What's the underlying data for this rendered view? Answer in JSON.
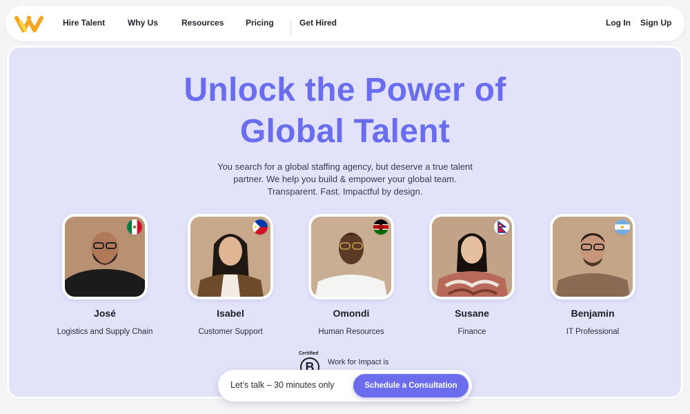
{
  "nav": {
    "items": [
      {
        "label": "Hire Talent"
      },
      {
        "label": "Why Us"
      },
      {
        "label": "Resources"
      },
      {
        "label": "Pricing"
      },
      {
        "label": "Get Hired"
      }
    ],
    "login": "Log In",
    "signup": "Sign Up"
  },
  "hero": {
    "headline_line1": "Unlock the Power of",
    "headline_line2": "Global Talent",
    "sub_line1": "You search for a global staffing agency, but deserve a true talent",
    "sub_line2": "partner. We help you build & empower your global team.",
    "sub_line3": "Transparent. Fast. Impactful by design."
  },
  "people": [
    {
      "name": "José",
      "role": "Logistics and Supply Chain",
      "flag": "mexico-flag"
    },
    {
      "name": "Isabel",
      "role": "Customer Support",
      "flag": "philippines-flag"
    },
    {
      "name": "Omondi",
      "role": "Human Resources",
      "flag": "kenya-flag"
    },
    {
      "name": "Susane",
      "role": "Finance",
      "flag": "nepal-flag"
    },
    {
      "name": "Benjamin",
      "role": "IT Professional",
      "flag": "argentina-flag"
    }
  ],
  "certification": {
    "label": "Certified",
    "mark": "B",
    "text": "Work for Impact is"
  },
  "cta": {
    "text": "Let’s talk – 30 minutes only",
    "button": "Schedule a Consultation"
  },
  "colors": {
    "accent": "#6a6ded",
    "hero_background": "#e2e3fb",
    "logo_orange": "#f6a623",
    "logo_yellow": "#ffd34e"
  }
}
